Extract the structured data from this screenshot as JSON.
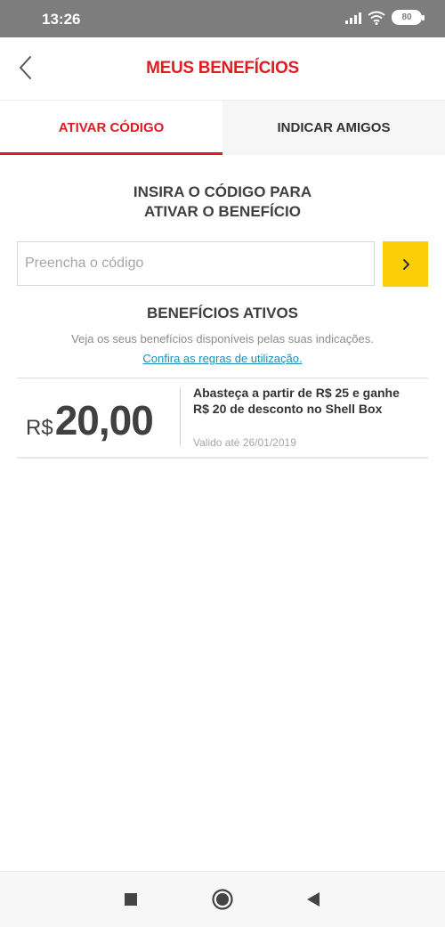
{
  "status_bar": {
    "time": "13:26",
    "battery": "80",
    "icons": [
      "signal-icon",
      "wifi-icon",
      "battery-icon"
    ]
  },
  "header": {
    "title": "MEUS BENEFÍCIOS",
    "back_icon": "chevron-left-icon"
  },
  "tabs": [
    {
      "label": "ATIVAR CÓDIGO",
      "active": true
    },
    {
      "label": "INDICAR AMIGOS",
      "active": false
    }
  ],
  "activation": {
    "title_line1": "INSIRA O CÓDIGO PARA",
    "title_line2": "ATIVAR O BENEFÍCIO",
    "input_placeholder": "Preencha o código",
    "input_value": "",
    "submit_icon": "chevron-right-icon"
  },
  "benefits": {
    "title": "BENEFÍCIOS ATIVOS",
    "description": "Veja os seus benefícios disponíveis pelas suas indicações.",
    "rules_link": "Confira as regras de utilização.",
    "items": [
      {
        "currency": "R$",
        "amount": "20,00",
        "text": "Abasteça a partir de R$ 25 e ganhe R$ 20 de desconto no Shell Box",
        "validity": "Valido até 26/01/2019"
      }
    ]
  },
  "nav_bar": {
    "icons": [
      "recent-apps-icon",
      "home-icon",
      "back-icon"
    ]
  },
  "colors": {
    "brand_red": "#dd1d21",
    "brand_yellow": "#fbce07",
    "link_blue": "#1a8fb8"
  }
}
